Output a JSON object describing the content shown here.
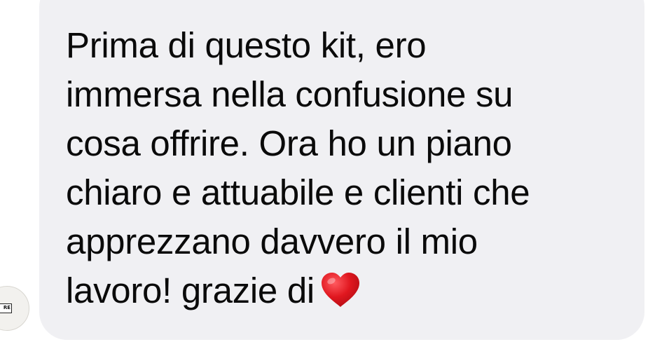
{
  "chat": {
    "avatar": {
      "badge_text": "RE"
    },
    "message": {
      "lines": [
        "Prima di questo kit, ero",
        "immersa nella confusione su",
        "cosa offrire. Ora ho un piano",
        "chiaro e attuabile e clienti che",
        "apprezzano davvero il mio",
        "lavoro! grazie di"
      ],
      "emoji": "heart-icon"
    }
  },
  "colors": {
    "bubble_background": "#f0f0f3",
    "text": "#0a0a0a",
    "heart": "#e0171f"
  }
}
